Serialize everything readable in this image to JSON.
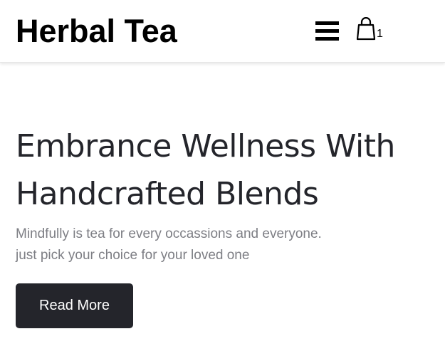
{
  "header": {
    "brand": "Herbal Tea",
    "menu_icon": "hamburger-menu-icon",
    "cart_icon": "shopping-bag-icon",
    "cart_count": "1"
  },
  "hero": {
    "title_line1": "Embrance Wellness With",
    "title_line2": "Handcrafted Blends",
    "subtitle_line1": "Mindfully is tea for every occassions and everyone.",
    "subtitle_line2": "just pick your choice for your loved one",
    "cta_label": "Read More"
  },
  "colors": {
    "background": "#ffffff",
    "text_dark": "#24252b",
    "text_muted": "#7d7e84",
    "button_bg": "#24252b",
    "button_text": "#ffffff"
  }
}
